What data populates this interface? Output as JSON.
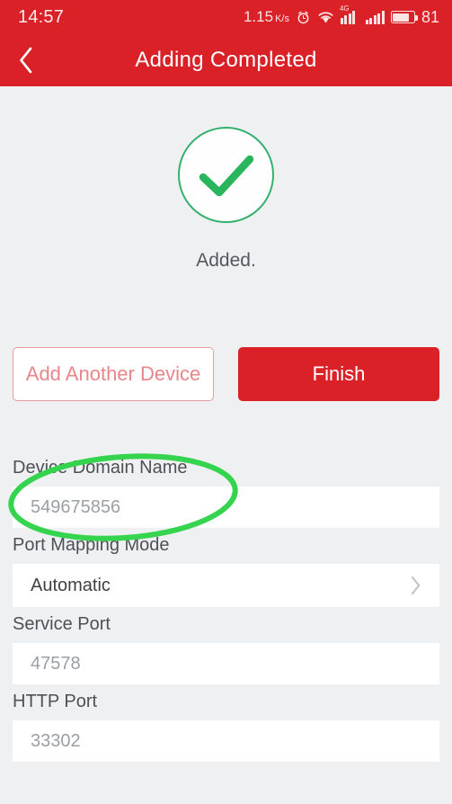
{
  "status_bar": {
    "time": "14:57",
    "network_speed": "1.15",
    "network_speed_unit": "K/s",
    "alarm_icon": "alarm-clock-icon",
    "wifi_icon": "wifi-icon",
    "signal_1_label": "4G",
    "signal_1_icon": "cellular-signal-icon",
    "signal_2_icon": "cellular-signal-icon",
    "battery_icon": "battery-icon",
    "battery_level": "81"
  },
  "header": {
    "back_icon": "chevron-left-icon",
    "title": "Adding Completed"
  },
  "result": {
    "status_icon": "checkmark-circle-icon",
    "message": "Added."
  },
  "actions": {
    "add_another_label": "Add Another Device",
    "finish_label": "Finish"
  },
  "form": {
    "fields": [
      {
        "label": "Device Domain Name",
        "value": "549675856",
        "type": "text",
        "muted": true
      },
      {
        "label": "Port Mapping Mode",
        "value": "Automatic",
        "type": "select",
        "muted": false,
        "chevron": "chevron-right-icon"
      },
      {
        "label": "Service Port",
        "value": "47578",
        "type": "text",
        "muted": true
      },
      {
        "label": "HTTP Port",
        "value": "33302",
        "type": "text",
        "muted": true
      }
    ]
  },
  "annotation": {
    "shape": "ellipse-highlight",
    "color": "#35d44f",
    "target": "Device Domain Name"
  },
  "colors": {
    "brand_red": "#da2128",
    "outline_red": "#e8868a",
    "success_green": "#36b06d",
    "annotation_green": "#35d44f",
    "page_background": "#eff0f2",
    "field_background": "#ffffff"
  }
}
